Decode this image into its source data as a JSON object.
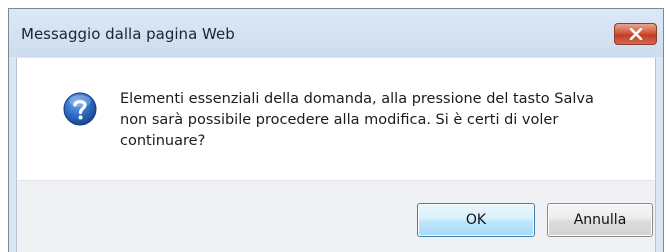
{
  "dialog": {
    "title": "Messaggio dalla pagina Web",
    "icon": "question-icon",
    "close_icon": "close-icon",
    "message": "Elementi essenziali della domanda, alla pressione del tasto Salva non sarà possibile procedere alla modifica. Si è certi di voler continuare?",
    "buttons": {
      "ok_label": "OK",
      "cancel_label": "Annulla"
    }
  },
  "colors": {
    "titlebar": "#cddcee",
    "close_button": "#c43b23",
    "icon_blue": "#1f5bb0",
    "default_button_border": "#3c7fb1"
  }
}
